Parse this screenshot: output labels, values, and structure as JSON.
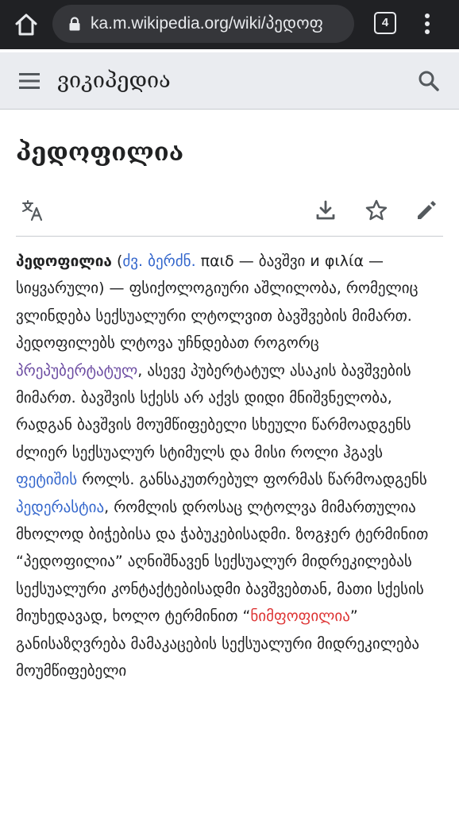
{
  "browser": {
    "url": "ka.m.wikipedia.org/wiki/პედოფ",
    "tab_count": "4"
  },
  "header": {
    "site_title": "ვიკიპედია"
  },
  "page": {
    "title": "პედოფილია"
  },
  "article": {
    "term": "პედოფილია",
    "p_open": " (",
    "etym_link": "ძვ. ბერძნ.",
    "etym_text": " παιδ — ბავშვი и φιλία — სიყვარული) — ფსიქოლოგიური აშლილობა, რომელიც ვლინდება სექსუალური ლტოლვით ბავშვების მიმართ. პედოფილებს ლტოვა უჩნდებათ როგორც ",
    "link_prepubertal": "პრეპუბერტატულ",
    "text_2": ", ასევე პუბერტატულ ასაკის ბავშვების მიმართ. ბავშვის სქესს არ აქვს დიდი მნიშვნელობა, რადგან ბავშვის მოუმწიფებელი სხეული წარმოადგენს ძლიერ სექსუალურ სტიმულს და მისი როლი ჰგავს ",
    "link_fetish": "ფეტიშის",
    "text_3": " როლს. განსაკუთრებულ ფორმას წარმოადგენს ",
    "link_pederasty": "პედერასტია",
    "text_4": ", რომლის დროსაც ლტოლვა მიმართულია მხოლოდ ბიჭებისა და ჭაბუკებისადმი. ზოგჯერ ტერმინით “პედოფილია” აღნიშნავენ სექსუალურ მიდრეკილებას სექსუალური კონტაქტებისადმი ბავშვებთან, მათი სქესის მიუხედავად, ხოლო ტერმინით “",
    "link_nympho": "ნიმფოფილია",
    "text_5": "” განისაზღვრება მამაკაცების სექსუალური მიდრეკილება მოუმწიფებელი"
  },
  "colors": {
    "chrome_bg": "#202124",
    "link": "#3366cc",
    "link_visited": "#6b4ba1",
    "link_new": "#dd3333"
  }
}
